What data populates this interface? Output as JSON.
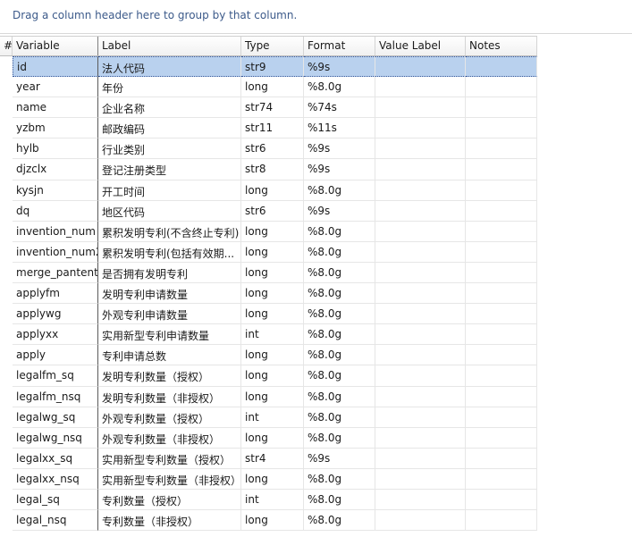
{
  "group_bar": {
    "hint": "Drag a column header here to group by that column."
  },
  "columns": [
    "#",
    "Variable",
    "Label",
    "Type",
    "Format",
    "Value Label",
    "Notes"
  ],
  "rows": [
    {
      "variable": "id",
      "label": "法人代码",
      "type": "str9",
      "format": "%9s"
    },
    {
      "variable": "year",
      "label": "年份",
      "type": "long",
      "format": "%8.0g"
    },
    {
      "variable": "name",
      "label": "企业名称",
      "type": "str74",
      "format": "%74s"
    },
    {
      "variable": "yzbm",
      "label": "邮政编码",
      "type": "str11",
      "format": "%11s"
    },
    {
      "variable": "hylb",
      "label": "行业类别",
      "type": "str6",
      "format": "%9s"
    },
    {
      "variable": "djzclx",
      "label": "登记注册类型",
      "type": "str8",
      "format": "%9s"
    },
    {
      "variable": "kysjn",
      "label": "开工时间",
      "type": "long",
      "format": "%8.0g"
    },
    {
      "variable": "dq",
      "label": "地区代码",
      "type": "str6",
      "format": "%9s"
    },
    {
      "variable": "invention_num",
      "label": "累积发明专利(不含终止专利)",
      "type": "long",
      "format": "%8.0g"
    },
    {
      "variable": "invention_num2",
      "label": "累积发明专利(包括有效期...",
      "type": "long",
      "format": "%8.0g"
    },
    {
      "variable": "merge_pantent",
      "label": "是否拥有发明专利",
      "type": "long",
      "format": "%8.0g"
    },
    {
      "variable": "applyfm",
      "label": "发明专利申请数量",
      "type": "long",
      "format": "%8.0g"
    },
    {
      "variable": "applywg",
      "label": "外观专利申请数量",
      "type": "long",
      "format": "%8.0g"
    },
    {
      "variable": "applyxx",
      "label": "实用新型专利申请数量",
      "type": "int",
      "format": "%8.0g"
    },
    {
      "variable": "apply",
      "label": "专利申请总数",
      "type": "long",
      "format": "%8.0g"
    },
    {
      "variable": "legalfm_sq",
      "label": "发明专利数量（授权）",
      "type": "long",
      "format": "%8.0g"
    },
    {
      "variable": "legalfm_nsq",
      "label": "发明专利数量（非授权）",
      "type": "long",
      "format": "%8.0g"
    },
    {
      "variable": "legalwg_sq",
      "label": "外观专利数量（授权）",
      "type": "int",
      "format": "%8.0g"
    },
    {
      "variable": "legalwg_nsq",
      "label": "外观专利数量（非授权）",
      "type": "long",
      "format": "%8.0g"
    },
    {
      "variable": "legalxx_sq",
      "label": "实用新型专利数量（授权）",
      "type": "str4",
      "format": "%9s"
    },
    {
      "variable": "legalxx_nsq",
      "label": "实用新型专利数量（非授权）",
      "type": "long",
      "format": "%8.0g"
    },
    {
      "variable": "legal_sq",
      "label": "专利数量（授权）",
      "type": "int",
      "format": "%8.0g"
    },
    {
      "variable": "legal_nsq",
      "label": "专利数量（非授权）",
      "type": "long",
      "format": "%8.0g"
    }
  ]
}
